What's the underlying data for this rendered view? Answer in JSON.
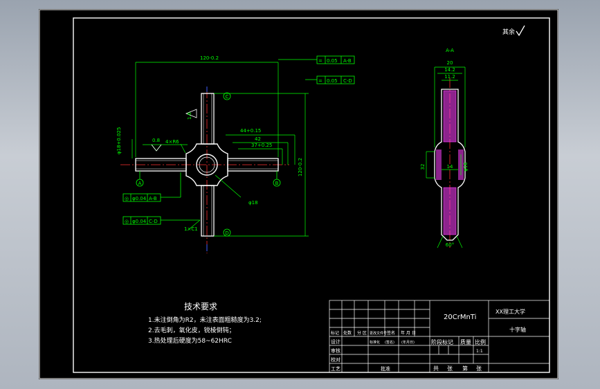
{
  "colors": {
    "frame": "#ffffff",
    "dim": "#00ff00",
    "center": "#ff3030",
    "blue": "#4060ff",
    "hatch": "#ff40ff",
    "text": "#ffffff",
    "part": "#ffffff"
  },
  "roughness_symbol": "其余",
  "dims": {
    "width_120": "120-0.2",
    "dia18_upper": "φ18+0.025",
    "chamfer": "4×R6",
    "rough_08": "0.8",
    "rough_16": "1.6",
    "d44": "44+0.15",
    "d42": "42",
    "d37": "37+0.25",
    "height_120": "120-0.2",
    "d_phi18": "φ18",
    "d_c1": "1×C1"
  },
  "fcf": {
    "sym_a": "=|0.05|A-B",
    "sym_c": "=|0.05|C-D",
    "pos_a": "◎|φ0.04|A-B",
    "pos_c": "◎|φ0.04|C-D"
  },
  "datums": {
    "a": "A",
    "b": "B",
    "c": "C",
    "d": "D"
  },
  "section": {
    "label": "A-A",
    "w20": "20",
    "w142": "14.2",
    "w112": "11.2",
    "v32": "32",
    "v14": "14",
    "v16": "φ16",
    "angle": "60°"
  },
  "tech": {
    "title": "技术要求",
    "line1": "1.未注倒角为R2，未注表面粗糙度为3.2;",
    "line2": "2.去毛刺，氧化皮，锐棱倒钝；",
    "line3": "3.热处理后硬度为58~62HRC"
  },
  "title_block": {
    "material": "20CrMnTi",
    "school": "XX理工大学",
    "part_name": "十字轴",
    "r_biaoji": "标记",
    "r_chushu": "处数",
    "r_fenqu": "分 区",
    "r_gengai": "更改文件号",
    "r_qianming": "签名",
    "r_nianyueri": "年 月 日",
    "r_sheji": "设计",
    "r_biaozhunhua": "标准化",
    "r_qianming2": "(签名)",
    "r_nianyueri2": "(年月日)",
    "r_jieduan": "阶段标记",
    "r_zhongliang": "质量",
    "r_bili": "比例",
    "r_scale": "1:1",
    "r_shenhe": "审核",
    "r_jiaodui": "校对",
    "r_gongyi": "工艺",
    "r_pizhun": "批准",
    "r_gong": "共",
    "r_zhang": "张",
    "r_di": "第",
    "r_zhang2": "张"
  }
}
